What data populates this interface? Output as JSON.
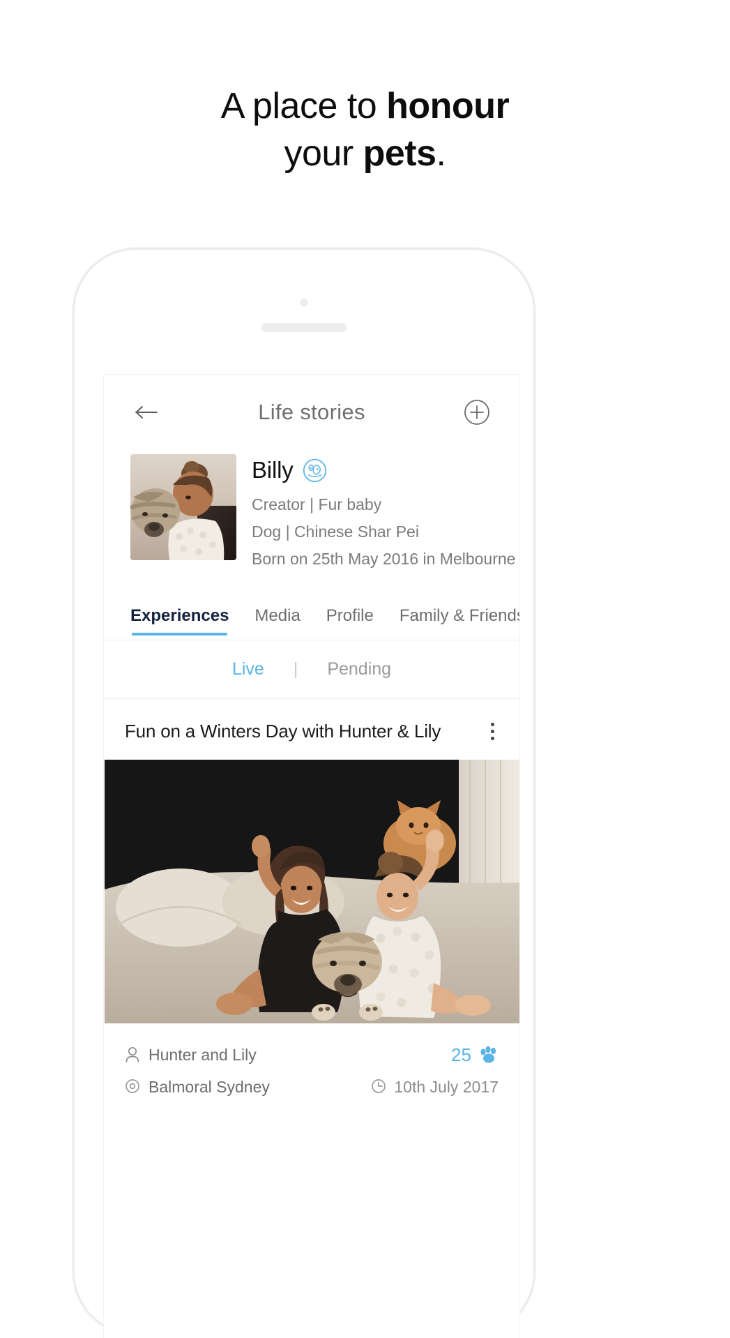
{
  "hero": {
    "line1_plain": "A place to ",
    "line1_bold": "honour",
    "line2_plain": "your ",
    "line2_bold": "pets",
    "line2_tail": "."
  },
  "app": {
    "header": {
      "title": "Life stories",
      "back_icon": "arrow-left-icon",
      "add_icon": "plus-circle-icon"
    },
    "profile": {
      "name": "Billy",
      "badge_icon": "pet-globe-badge-icon",
      "meta": [
        "Creator | Fur baby",
        "Dog | Chinese Shar Pei",
        "Born on 25th May 2016 in Melbourne"
      ]
    },
    "tabs": [
      {
        "label": "Experiences",
        "active": true
      },
      {
        "label": "Media",
        "active": false
      },
      {
        "label": "Profile",
        "active": false
      },
      {
        "label": "Family & Friends",
        "active": false
      }
    ],
    "filter": {
      "live": "Live",
      "separator": "|",
      "pending": "Pending"
    },
    "story": {
      "title": "Fun on a Winters Day with Hunter & Lily",
      "menu_icon": "kebab-menu-icon",
      "author": "Hunter and Lily",
      "author_icon": "person-icon",
      "reaction_count": "25",
      "reaction_icon": "paw-icon",
      "location": "Balmoral Sydney",
      "location_icon": "location-pin-icon",
      "date": "10th July 2017",
      "date_icon": "clock-icon"
    }
  },
  "colors": {
    "accent_blue": "#5ab4e6",
    "tab_active": "#15233f",
    "muted_gray": "#7b7b7b"
  }
}
